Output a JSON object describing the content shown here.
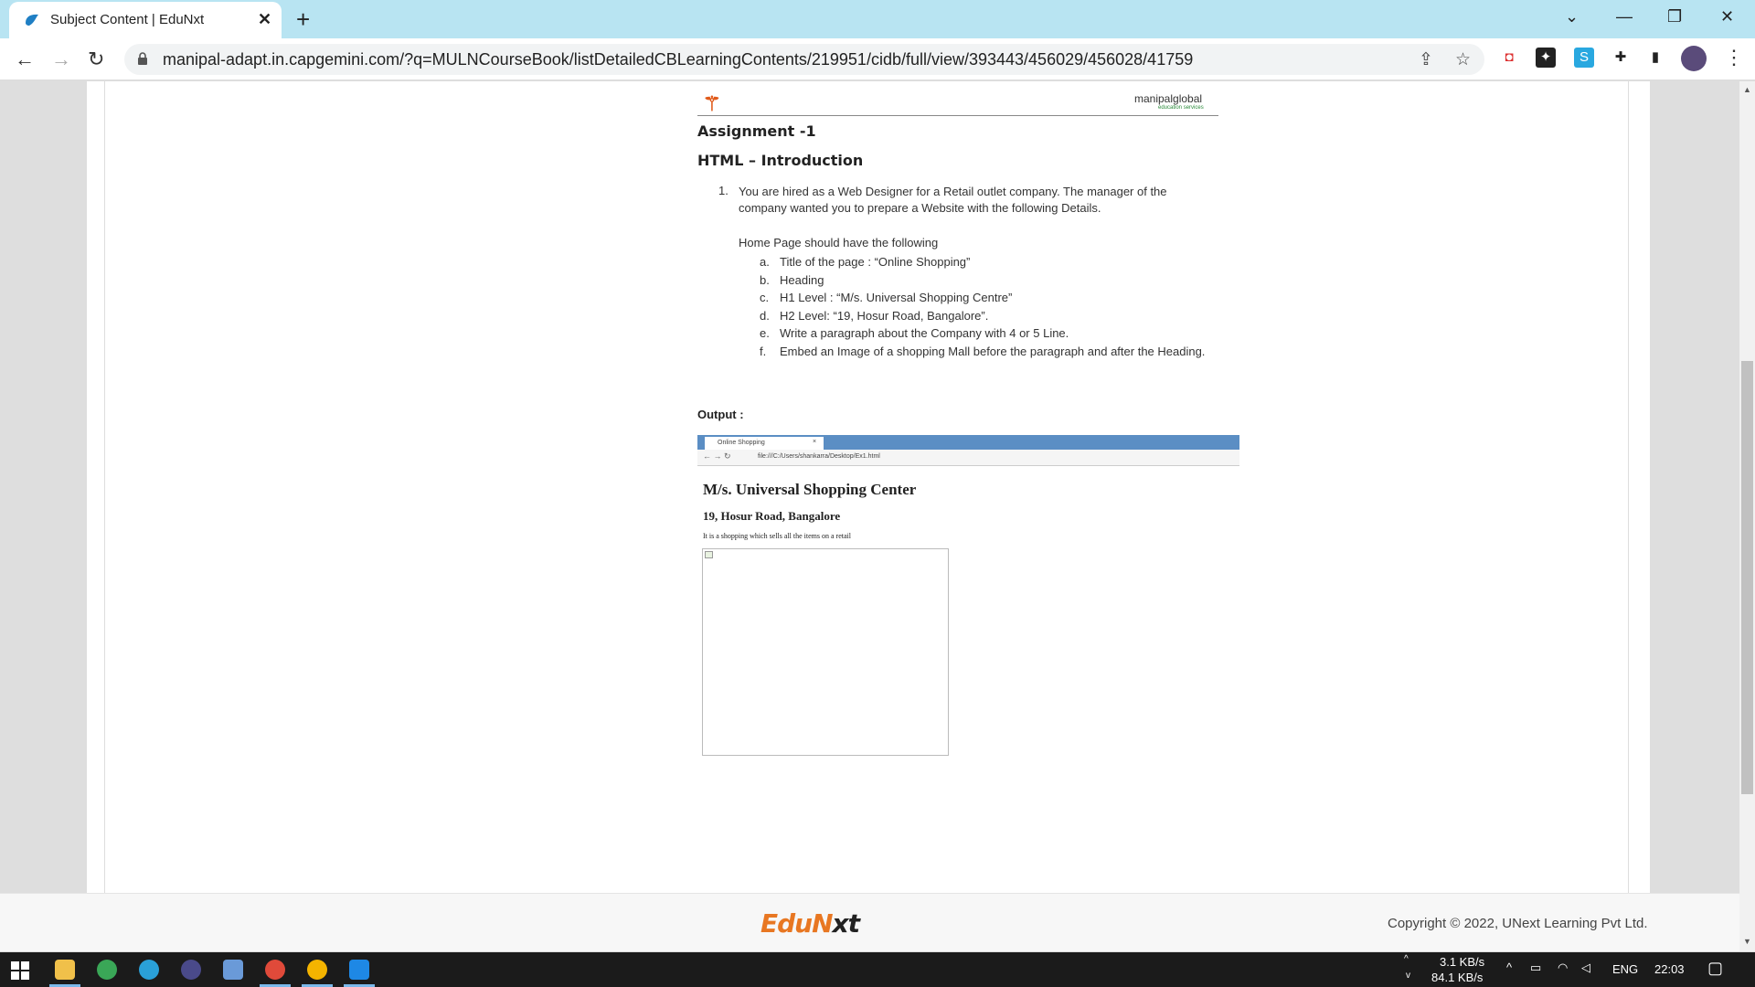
{
  "browser": {
    "tab_title": "Subject Content | EduNxt",
    "url": "manipal-adapt.in.capgemini.com/?q=MULNCourseBook/listDetailedCBLearningContents/219951/cidb/full/view/393443/456029/456028/41759"
  },
  "document": {
    "logo_right": "manipalglobal",
    "logo_sub": "education services",
    "assignment_title": "Assignment -1",
    "section_title": "HTML – Introduction",
    "question_number": "1.",
    "question_text": "You are hired as a Web Designer for a Retail outlet company. The manager of the company wanted you to prepare a Website with the following Details.",
    "home_intro": "Home Page should have the following",
    "items": [
      {
        "marker": "a.",
        "text": "Title of the page : “Online Shopping”"
      },
      {
        "marker": "b.",
        "text": "Heading"
      },
      {
        "marker": "c.",
        "text": "H1 Level : “M/s. Universal Shopping Centre”"
      },
      {
        "marker": "d.",
        "text": "H2 Level: “19, Hosur Road, Bangalore”."
      },
      {
        "marker": "e.",
        "text": "Write a paragraph about the Company with 4 or 5 Line."
      },
      {
        "marker": "f.",
        "text": "Embed an Image of a shopping Mall before the paragraph and after the Heading."
      }
    ],
    "output_label": "Output :",
    "output_shot": {
      "tab": "Online Shopping",
      "url": "file:///C:/Users/shankarra/Desktop/Ex1.html",
      "h1": "M/s. Universal Shopping Center",
      "h2": "19, Hosur Road, Bangalore",
      "paragraph": "It is a shopping which sells all the items on a retail"
    }
  },
  "footer": {
    "brand_a": "EduN",
    "brand_b": "xt",
    "copyright": "Copyright © 2022, UNext Learning Pvt Ltd."
  },
  "taskbar": {
    "net_up": "3.1 KB/s",
    "net_down": "84.1 KB/s",
    "lang": "ENG",
    "time": "22:03"
  }
}
